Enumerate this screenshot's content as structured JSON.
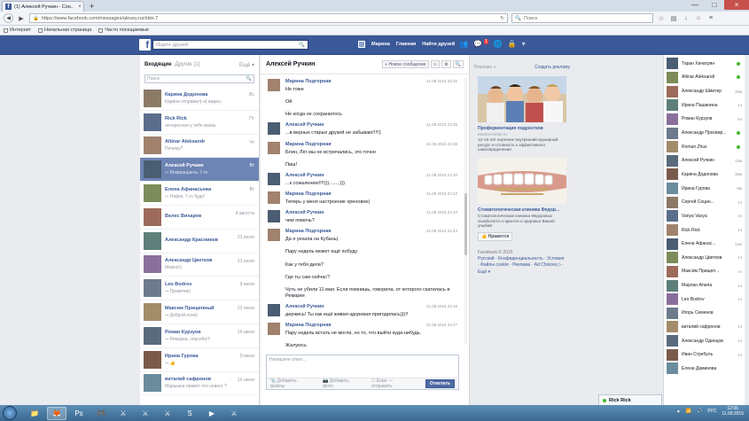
{
  "browser": {
    "tab_title": "(1) Алексей Ручкин - Соо...",
    "tab_close": "×",
    "new_tab": "+",
    "url": "https://www.facebook.com/messages/alexey.ruchkin.7",
    "search_placeholder": "Поиск",
    "bookmarks": [
      "Интернет",
      "Начальная страница",
      "Часто посещаемые"
    ],
    "window_controls": [
      "—",
      "□",
      "×"
    ]
  },
  "fb_header": {
    "logo": "f",
    "search_placeholder": "Ищите друзей",
    "nav": [
      "Марина",
      "Главная",
      "Найти друзей"
    ],
    "notif_count": "1"
  },
  "threads": {
    "inbox": "Входящие",
    "other": "Другие (1)",
    "more": "Ещё ▾",
    "search_placeholder": "Поиск",
    "items": [
      {
        "name": "Карина Додонова",
        "snippet": "Карина отправил(-а) видео.",
        "time": "Вс"
      },
      {
        "name": "Rick Rick",
        "snippet": "интересная у тебя жизнь",
        "time": "Пт"
      },
      {
        "name": "Altinar Aleksandr",
        "snippet": "Почему?",
        "time": "Чт"
      },
      {
        "name": "Алексей Ручкин",
        "snippet": "↪ Возвращаюсь 7-го",
        "time": "Вт"
      },
      {
        "name": "Елена Афанасьева",
        "snippet": "↪ Нафиг, 7-го буду!",
        "time": "Вт"
      },
      {
        "name": "Велес Вихарев",
        "snippet": "",
        "time": "4 августа"
      },
      {
        "name": "Александр Красников",
        "snippet": "",
        "time": "21 июля"
      },
      {
        "name": "Александр Цветков",
        "snippet": "Можно!)",
        "time": "13 июля"
      },
      {
        "name": "Leo Bodrov",
        "snippet": "↪ Приветик)",
        "time": "9 июля"
      },
      {
        "name": "Максим Прищепный",
        "snippet": "↪ Доброй ночи)",
        "time": "23 июня"
      },
      {
        "name": "Роман Курзуов",
        "snippet": "↪ Ремарка, спасибо!!!",
        "time": "16 июня"
      },
      {
        "name": "Ирина Гурова",
        "snippet": "↪ 👍",
        "time": "9 июня"
      },
      {
        "name": "виталий сафронов",
        "snippet": "Марышка привет что нового ?",
        "time": "16 июня"
      }
    ]
  },
  "conversation": {
    "title": "Алексей Ручкин",
    "new_message": "+ Новое сообщение",
    "messages": [
      {
        "author": "Марина Подгорная",
        "time": "21.08.2015 22:32",
        "lines": [
          "Не тоже",
          "Ой",
          "Не когда не сохранилось"
        ]
      },
      {
        "author": "Алексей Ручкин",
        "time": "21.08.2015 22:35",
        "lines": [
          "...в верных старых друзей не забываю!!!!!)"
        ]
      },
      {
        "author": "Марина Подгорная",
        "time": "21.08.2015 22:38",
        "lines": [
          "Блин, Лёг мы не встречались, это точно",
          "Пиш!"
        ]
      },
      {
        "author": "Алексей Ручкин",
        "time": "21.08.2015 22:40",
        "lines": [
          "...к сожалению!!!!)))........)))"
        ]
      },
      {
        "author": "Марина Подгорная",
        "time": "21.08.2015 22:42",
        "lines": [
          "Теперь у меня настроение хреновое("
        ]
      },
      {
        "author": "Алексей Ручкин",
        "time": "21.08.2015 22:42",
        "lines": [
          "чем помочь?"
        ]
      },
      {
        "author": "Марина Подгорная",
        "time": "21.08.2015 22:43",
        "lines": [
          "Да я уехала на Кубань(",
          "Пару недель может ещё побуду",
          "Как у тебя дела?",
          "Где ты сам сейчас?",
          "Чуть не убили 11 мая. Если помнишь, говорила, от которого скатилась в Ремарке"
        ]
      },
      {
        "author": "Алексей Ручкин",
        "time": "21.08.2015 22:46",
        "lines": [
          "держись! Ты как ещё живая-здоровая пригодилась)))!!"
        ]
      },
      {
        "author": "Марина Подгорная",
        "time": "21.08.2015 22:47",
        "lines": [
          "Пару недель встать не могла, но то, что выйти куда-нибудь.",
          "Жалуюсь"
        ]
      }
    ],
    "composer_placeholder": "Напишите ответ...",
    "add_files": "Добавить файлы",
    "add_photo": "Добавить фото",
    "enter_send": "Enter — отправить",
    "reply": "Ответить"
  },
  "ads": {
    "header": "Реклама ➶",
    "create": "Создать рекламу",
    "items": [
      {
        "title": "Профориентация подростков",
        "domain": "ebrami-center.ru",
        "desc": "12–16 лет изучение внутренний карьерный ресурс и готовность к эффективного самоопределения"
      },
      {
        "title": "Стоматологическая клиника Федор...",
        "domain": "",
        "desc": "Стоматологическая клиника Федоровых позаботится о красоте и здоровье Вашей улыбки!"
      }
    ],
    "like": "Нравится",
    "footer_copy": "Facebook © 2015",
    "footer_links": "Русский · Конфиденциальность · Условия · Файлы cookie · Реклама · Ad Choices ▷ · Ещё ▾"
  },
  "chat": {
    "buddies": [
      {
        "name": "Таран Хачатрян",
        "status": "online"
      },
      {
        "name": "Altinar Aleksandr",
        "status": "online"
      },
      {
        "name": "Александр Шмитер",
        "status": "10м"
      },
      {
        "name": "Ирина Пашинина",
        "status": "1ч"
      },
      {
        "name": "Роман Курзуов",
        "status": "5ч"
      },
      {
        "name": "Александр Просвир...",
        "status": "online"
      },
      {
        "name": "Roman Zhux",
        "status": "online"
      },
      {
        "name": "Алексей Ручкин",
        "status": "12м"
      },
      {
        "name": "Карина Додонова",
        "status": "18м"
      },
      {
        "name": "Ирина Гурова",
        "status": "6м"
      },
      {
        "name": "Сергей Социн...",
        "status": "1ч"
      },
      {
        "name": "Vanya Vasya",
        "status": "1ч"
      },
      {
        "name": "Rick Rick",
        "status": "1ч"
      },
      {
        "name": "Елена Афанас...",
        "status": "14м"
      },
      {
        "name": "Александр Цветков",
        "status": "1ч"
      },
      {
        "name": "Максим Прищеп...",
        "status": "1ч"
      },
      {
        "name": "Марлан Атмла",
        "status": "1ч"
      },
      {
        "name": "Leo Bodrov",
        "status": "1ч"
      },
      {
        "name": "Игорь Семенов",
        "status": ""
      },
      {
        "name": "виталий сафронов",
        "status": "1ч"
      },
      {
        "name": "Александр Одинцов",
        "status": "1ч"
      },
      {
        "name": "Иван Стребуль",
        "status": "1ч"
      },
      {
        "name": "Елена Даминова",
        "status": ""
      }
    ],
    "open_tab": "Rick Rick"
  },
  "taskbar": {
    "lang": "РУС",
    "time": "12:06",
    "date": "11.09.2015"
  },
  "colors": {
    "fb_blue": "#3b5998",
    "active_thread": "#6d84b4",
    "online": "#42b72a"
  }
}
